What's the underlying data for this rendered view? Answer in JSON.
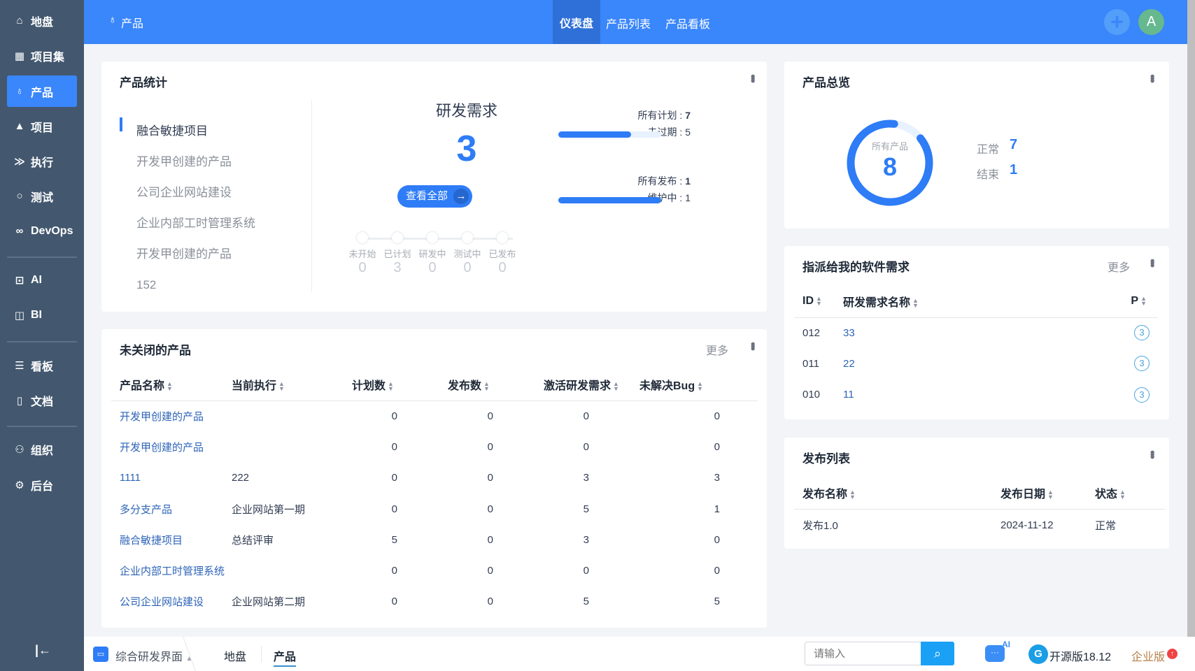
{
  "sidebar": {
    "items": [
      {
        "label": "地盘",
        "icon": "home-icon"
      },
      {
        "label": "项目集",
        "icon": "grid-icon"
      },
      {
        "label": "产品",
        "icon": "bulb-icon"
      },
      {
        "label": "项目",
        "icon": "rocket-icon"
      },
      {
        "label": "执行",
        "icon": "run-icon"
      },
      {
        "label": "测试",
        "icon": "search-icon"
      },
      {
        "label": "DevOps",
        "icon": "infinity-icon"
      },
      {
        "label": "AI",
        "icon": "robot-icon"
      },
      {
        "label": "BI",
        "icon": "chart-icon"
      },
      {
        "label": "看板",
        "icon": "board-icon"
      },
      {
        "label": "文档",
        "icon": "doc-icon"
      },
      {
        "label": "组织",
        "icon": "users-icon"
      },
      {
        "label": "后台",
        "icon": "gear-icon"
      }
    ]
  },
  "topbar": {
    "title": "产品",
    "tabs": [
      "仪表盘",
      "产品列表",
      "产品看板"
    ],
    "avatar": "A",
    "colors": {
      "brand": "#3a86fb"
    }
  },
  "stats": {
    "title": "产品统计",
    "products": [
      "融合敏捷项目",
      "开发甲创建的产品",
      "公司企业网站建设",
      "企业内部工时管理系统",
      "开发甲创建的产品",
      "152"
    ],
    "req_title": "研发需求",
    "req_count": "3",
    "view_all": "查看全部",
    "stages": [
      {
        "label": "未开始",
        "value": "0"
      },
      {
        "label": "已计划",
        "value": "3"
      },
      {
        "label": "研发中",
        "value": "0"
      },
      {
        "label": "测试中",
        "value": "0"
      },
      {
        "label": "已发布",
        "value": "0"
      }
    ],
    "plans_label": "所有计划 : ",
    "plans": "7",
    "unexpired_label": "未过期 : ",
    "unexpired": "5",
    "plan_progress": 0.71,
    "releases_label": "所有发布 : ",
    "releases": "1",
    "maintain_label": "维护中 : ",
    "maintain": "1",
    "release_progress": 1.0
  },
  "unclosed": {
    "title": "未关闭的产品",
    "more": "更多",
    "headers": [
      "产品名称",
      "当前执行",
      "计划数",
      "发布数",
      "激活研发需求",
      "未解决Bug"
    ],
    "rows": [
      [
        "开发甲创建的产品",
        "",
        "0",
        "0",
        "0",
        "0"
      ],
      [
        "开发甲创建的产品",
        "",
        "0",
        "0",
        "0",
        "0"
      ],
      [
        "1111",
        "222",
        "0",
        "0",
        "3",
        "3"
      ],
      [
        "多分支产品",
        "企业网站第一期",
        "0",
        "0",
        "5",
        "1"
      ],
      [
        "融合敏捷项目",
        "总结评审",
        "5",
        "0",
        "3",
        "0"
      ],
      [
        "企业内部工时管理系统",
        "",
        "0",
        "0",
        "0",
        "0"
      ],
      [
        "公司企业网站建设",
        "企业网站第二期",
        "0",
        "0",
        "5",
        "5"
      ]
    ]
  },
  "overview": {
    "title": "产品总览",
    "center_label": "所有产品",
    "total": "8",
    "normal_label": "正常",
    "normal": "7",
    "closed_label": "结束",
    "closed": "1"
  },
  "assigned": {
    "title": "指派给我的软件需求",
    "more": "更多",
    "headers": [
      "ID",
      "研发需求名称",
      "P"
    ],
    "rows": [
      [
        "012",
        "33",
        "3"
      ],
      [
        "011",
        "22",
        "3"
      ],
      [
        "010",
        "11",
        "3"
      ]
    ]
  },
  "releases": {
    "title": "发布列表",
    "headers": [
      "发布名称",
      "发布日期",
      "状态"
    ],
    "rows": [
      [
        "发布1.0",
        "2024-11-12",
        "正常"
      ]
    ]
  },
  "bottom": {
    "workspace": "综合研发界面",
    "crumbs": [
      "地盘",
      "产品"
    ],
    "search_placeholder": "请输入",
    "ai": "AI",
    "version": "开源版18.12",
    "enterprise": "企业版"
  }
}
